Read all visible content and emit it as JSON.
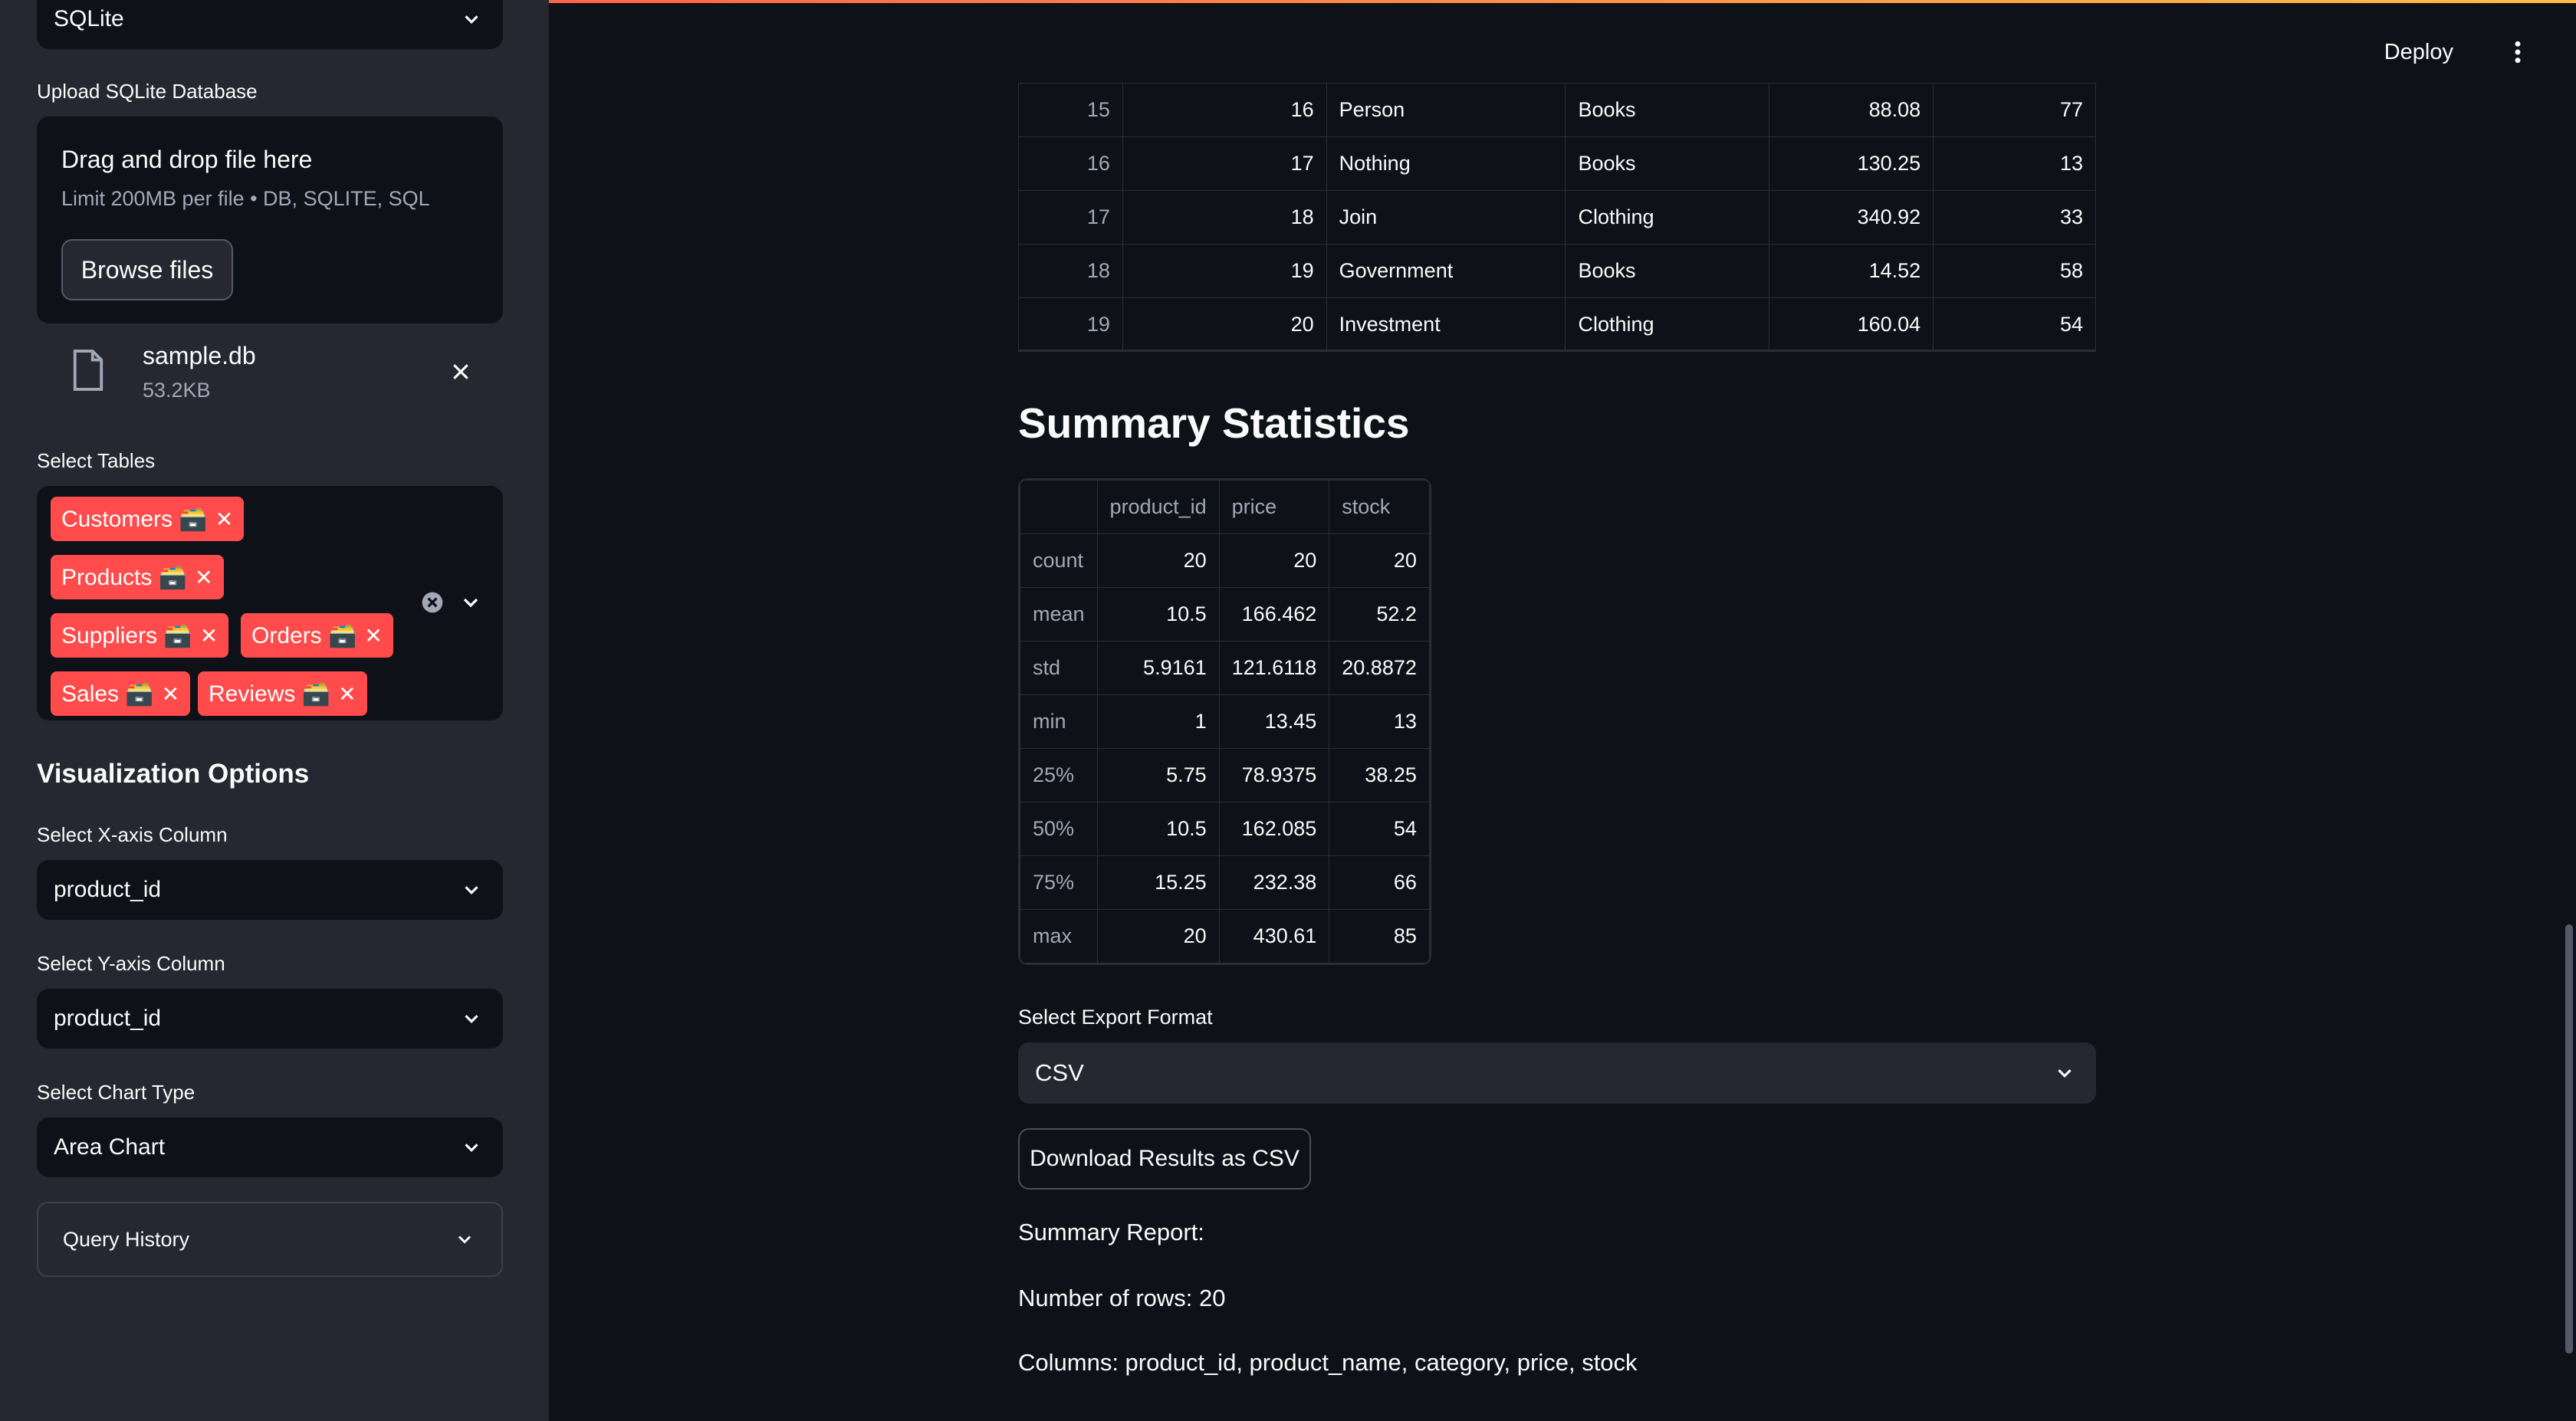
{
  "sidebar": {
    "db_type": "SQLite",
    "upload_label": "Upload SQLite Database",
    "drop_title": "Drag and drop file here",
    "drop_limit": "Limit 200MB per file • DB, SQLITE, SQL",
    "browse_label": "Browse files",
    "file_name": "sample.db",
    "file_size": "53.2KB",
    "tables_label": "Select Tables",
    "tables": [
      "Customers 🗃️",
      "Products 🗃️",
      "Suppliers 🗃️",
      "Orders 🗃️",
      "Sales 🗃️",
      "Reviews 🗃️"
    ],
    "viz_title": "Visualization Options",
    "x_label": "Select X-axis Column",
    "x_value": "product_id",
    "y_label": "Select Y-axis Column",
    "y_value": "product_id",
    "chart_label": "Select Chart Type",
    "chart_value": "Area Chart",
    "history_label": "Query History"
  },
  "header": {
    "deploy": "Deploy"
  },
  "data_rows": [
    [
      "15",
      "16",
      "Person",
      "Books",
      "88.08",
      "77"
    ],
    [
      "16",
      "17",
      "Nothing",
      "Books",
      "130.25",
      "13"
    ],
    [
      "17",
      "18",
      "Join",
      "Clothing",
      "340.92",
      "33"
    ],
    [
      "18",
      "19",
      "Government",
      "Books",
      "14.52",
      "58"
    ],
    [
      "19",
      "20",
      "Investment",
      "Clothing",
      "160.04",
      "54"
    ]
  ],
  "summary": {
    "title": "Summary Statistics",
    "columns": [
      "product_id",
      "price",
      "stock"
    ],
    "rows": [
      [
        "count",
        "20",
        "20",
        "20"
      ],
      [
        "mean",
        "10.5",
        "166.462",
        "52.2"
      ],
      [
        "std",
        "5.9161",
        "121.6118",
        "20.8872"
      ],
      [
        "min",
        "1",
        "13.45",
        "13"
      ],
      [
        "25%",
        "5.75",
        "78.9375",
        "38.25"
      ],
      [
        "50%",
        "10.5",
        "162.085",
        "54"
      ],
      [
        "75%",
        "15.25",
        "232.38",
        "66"
      ],
      [
        "max",
        "20",
        "430.61",
        "85"
      ]
    ]
  },
  "export": {
    "label": "Select Export Format",
    "value": "CSV",
    "button": "Download Results as CSV"
  },
  "report": {
    "heading": "Summary Report:",
    "rows_text": "Number of rows: 20",
    "columns_text": "Columns: product_id, product_name, category, price, stock"
  }
}
